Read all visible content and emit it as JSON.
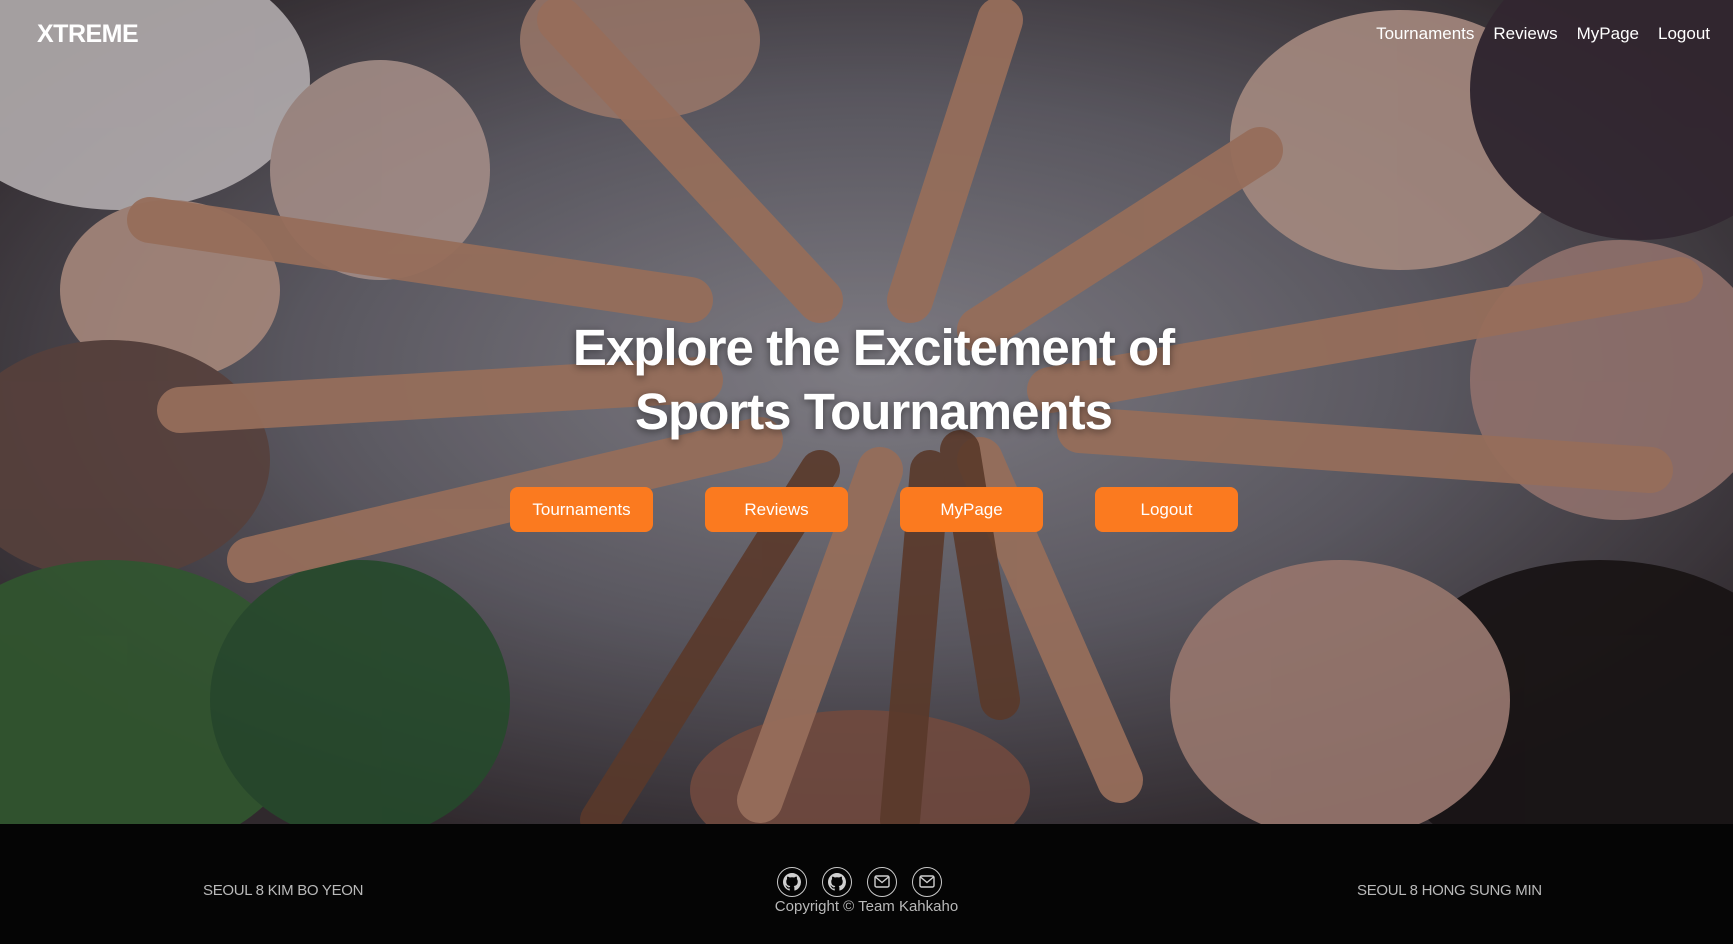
{
  "brand": {
    "logo": "XTREME"
  },
  "nav": {
    "items": [
      {
        "label": "Tournaments"
      },
      {
        "label": "Reviews"
      },
      {
        "label": "MyPage"
      },
      {
        "label": "Logout"
      }
    ]
  },
  "hero": {
    "title_line1": "Explore the Excitement of",
    "title_line2": "Sports Tournaments",
    "buttons": [
      {
        "label": "Tournaments"
      },
      {
        "label": "Reviews"
      },
      {
        "label": "MyPage"
      },
      {
        "label": "Logout"
      }
    ]
  },
  "footer": {
    "left_text": "SEOUL 8 KIM BO YEON",
    "right_text": "SEOUL 8 HONG SUNG MIN",
    "copyright": "Copyright © Team Kahkaho",
    "icons": [
      "github-icon",
      "github-icon",
      "mail-icon",
      "mail-icon"
    ]
  },
  "colors": {
    "accent": "#fb7a1f",
    "footer_bg": "#050505",
    "nav_text": "#ffffff"
  }
}
